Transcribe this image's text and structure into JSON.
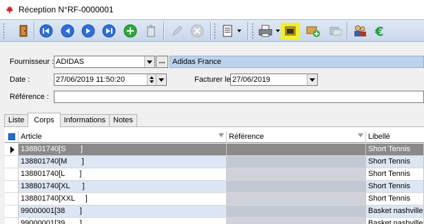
{
  "window": {
    "title": "Réception N°RF-0000001",
    "app_icon": "maple-leaf-icon"
  },
  "toolbar": {
    "buttons": [
      {
        "name": "exit-door-icon"
      },
      {
        "name": "first-record-icon"
      },
      {
        "name": "previous-record-icon"
      },
      {
        "name": "next-record-icon"
      },
      {
        "name": "last-record-icon"
      },
      {
        "name": "add-record-icon"
      },
      {
        "name": "delete-record-icon"
      },
      {
        "name": "edit-record-icon"
      },
      {
        "name": "cancel-record-icon"
      },
      {
        "name": "document-menu-icon"
      },
      {
        "name": "print-icon"
      },
      {
        "name": "toggle-panel-icon"
      },
      {
        "name": "add-package-icon"
      },
      {
        "name": "transfer-icon"
      },
      {
        "name": "users-icon"
      },
      {
        "name": "euro-icon"
      }
    ],
    "highlight_color": "#f0ef38"
  },
  "form": {
    "fournisseur": {
      "label": "Fournisseur :",
      "code": "ADIDAS",
      "name": "Adidas France",
      "ellipsis": "..."
    },
    "date": {
      "label": "Date :",
      "value": "27/06/2019 11:50:20"
    },
    "facturer": {
      "label": "Facturer le",
      "value": "27/06/2019"
    },
    "reference": {
      "label": "Référence :",
      "value": ""
    }
  },
  "tabs": [
    {
      "label": "Liste",
      "active": false
    },
    {
      "label": "Corps",
      "active": true
    },
    {
      "label": "Informations",
      "active": false
    },
    {
      "label": "Notes",
      "active": false
    }
  ],
  "grid": {
    "columns": [
      {
        "label": "Article"
      },
      {
        "label": "Référence"
      },
      {
        "label": "Libellé"
      }
    ],
    "rows": [
      {
        "article": "138801740[S       ]",
        "reference": "",
        "libelle": "Short Tennis",
        "selected": true
      },
      {
        "article": "138801740[M       ]",
        "reference": "",
        "libelle": "Short Tennis",
        "selected": false
      },
      {
        "article": "138801740[L       ]",
        "reference": "",
        "libelle": "Short Tennis",
        "selected": false
      },
      {
        "article": "138801740[XL      ]",
        "reference": "",
        "libelle": "Short Tennis",
        "selected": false
      },
      {
        "article": "138801740[XXL     ]",
        "reference": "",
        "libelle": "Short Tennis",
        "selected": false
      },
      {
        "article": "99000001[38       ]",
        "reference": "",
        "libelle": "Basket nashville",
        "selected": false
      },
      {
        "article": "99000001[39       ]",
        "reference": "",
        "libelle": "Basket nashville",
        "selected": false
      }
    ],
    "colors": {
      "selected_row": "#8a8a8a",
      "alt_row": "#dce6f4",
      "reference_col": "#cfd2d8",
      "reference_col_alt": "#c3c9d3"
    }
  }
}
